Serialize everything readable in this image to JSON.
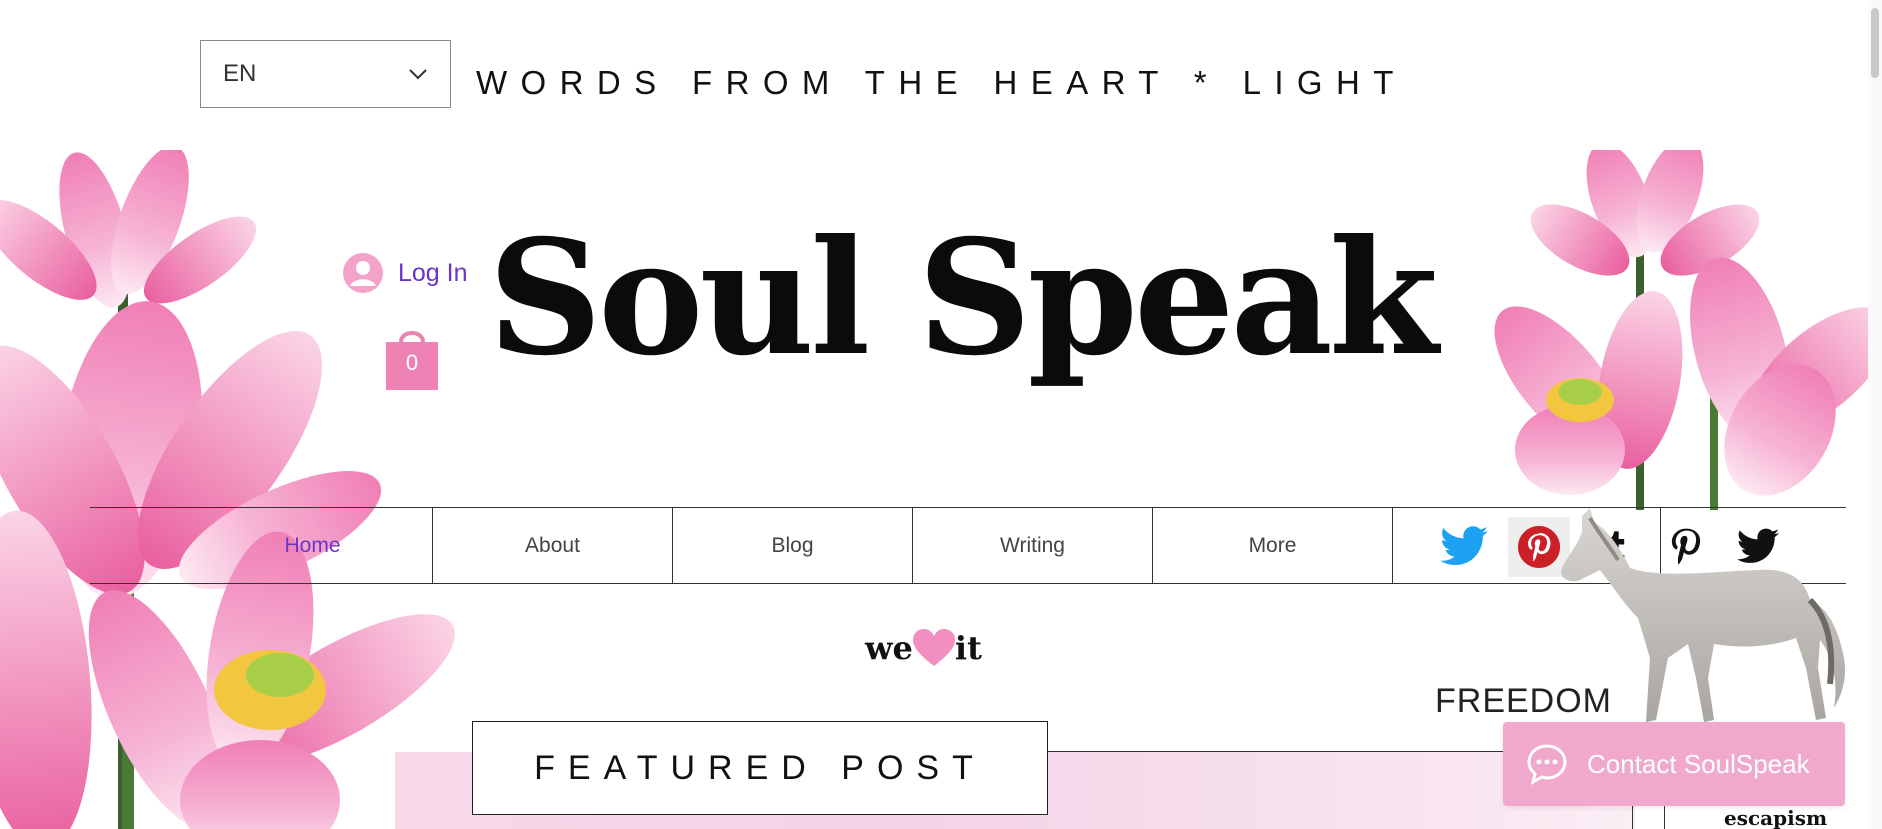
{
  "header": {
    "language": {
      "selected": "EN"
    },
    "tagline": "WORDS FROM THE HEART * LIGHT",
    "brand_title": "Soul Speak",
    "login_label": "Log In",
    "cart_count": "0"
  },
  "menu": {
    "items": [
      {
        "label": "Home"
      },
      {
        "label": "About"
      },
      {
        "label": "Blog"
      },
      {
        "label": "Writing"
      },
      {
        "label": "More"
      }
    ],
    "active": "Home"
  },
  "social": [
    "twitter-icon",
    "pinterest-icon",
    "tumblr-icon",
    "pinterest-icon",
    "twitter-icon"
  ],
  "content": {
    "we_love_prefix": "we",
    "we_love_suffix": "it",
    "freedom_label": "FREEDOM",
    "featured_label": "FEATURED POST",
    "escapism_label": "escapism"
  },
  "chat": {
    "label": "Contact SoulSpeak"
  },
  "colors": {
    "accent_purple": "#6b35c9",
    "brand_pink": "#ee82b4",
    "chat_pink": "#f0a9cc",
    "twitter_blue": "#1da1f2",
    "pinterest_red": "#cb2027"
  }
}
